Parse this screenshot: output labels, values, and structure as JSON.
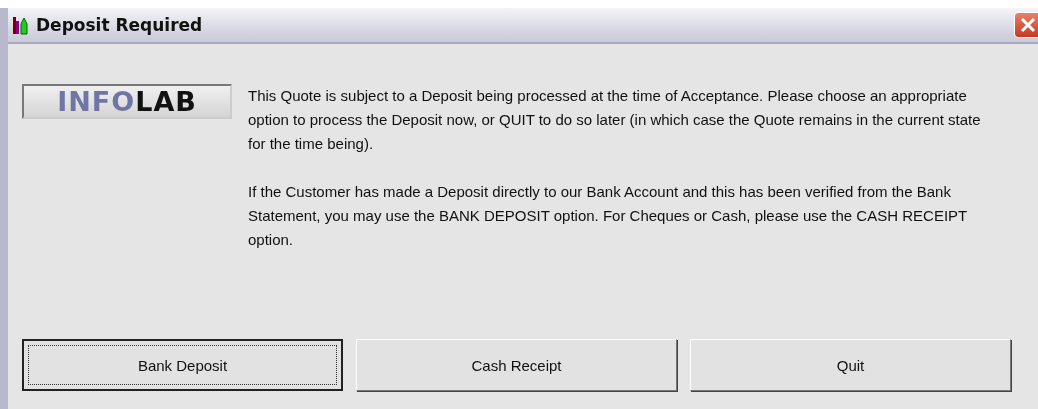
{
  "window": {
    "title": "Deposit Required"
  },
  "logo": {
    "parts": [
      {
        "text": "INFO",
        "kind": "light"
      },
      {
        "text": "LAB",
        "kind": "dark"
      }
    ]
  },
  "message": [
    "This Quote is subject to a Deposit being processed at the time of Acceptance. Please choose an appropriate option to process the Deposit now, or QUIT to do so later (in which case the Quote remains in the current state for the time being).",
    "If the Customer has made a Deposit directly to our Bank Account and this has been verified from the Bank Statement, you may use the BANK DEPOSIT option. For Cheques or Cash, please use the CASH RECEIPT option."
  ],
  "buttons": [
    {
      "label": "Bank Deposit",
      "focused": true
    },
    {
      "label": "Cash Receipt",
      "focused": false
    },
    {
      "label": "Quit",
      "focused": false
    }
  ]
}
